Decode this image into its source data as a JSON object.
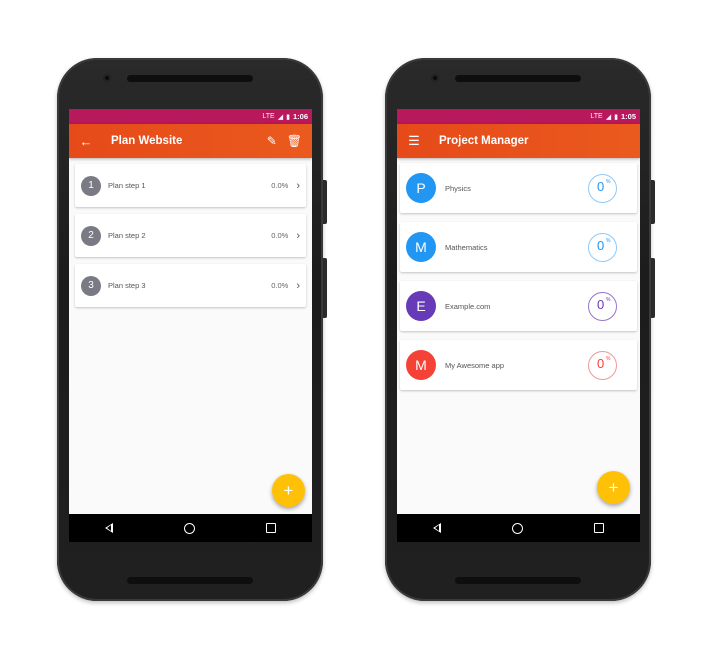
{
  "left_app": {
    "status": {
      "network": "LTE",
      "time": "1:06"
    },
    "toolbar": {
      "back_icon": "arrow-back-icon",
      "title": "Plan Website",
      "edit_icon": "pencil-icon",
      "delete_icon": "trash-icon"
    },
    "steps": [
      {
        "number": "1",
        "label": "Plan step 1",
        "percent": "0.0%"
      },
      {
        "number": "2",
        "label": "Plan step 2",
        "percent": "0.0%"
      },
      {
        "number": "3",
        "label": "Plan step 3",
        "percent": "0.0%"
      }
    ],
    "fab": "+"
  },
  "right_app": {
    "status": {
      "network": "LTE",
      "time": "1:05"
    },
    "toolbar": {
      "menu_icon": "hamburger-menu-icon",
      "title": "Project Manager"
    },
    "projects": [
      {
        "initial": "P",
        "name": "Physics",
        "value": "0",
        "unit": "%",
        "color": "#2196f3"
      },
      {
        "initial": "M",
        "name": "Mathematics",
        "value": "0",
        "unit": "%",
        "color": "#2196f3"
      },
      {
        "initial": "E",
        "name": "Example.com",
        "value": "0",
        "unit": "%",
        "color": "#673ab7"
      },
      {
        "initial": "M",
        "name": "My Awesome app",
        "value": "0",
        "unit": "%",
        "color": "#f44336"
      }
    ],
    "fab": "+"
  },
  "colors": {
    "status_bar": "#b8185c",
    "toolbar": "#e64a19",
    "fab": "#ffc107"
  }
}
